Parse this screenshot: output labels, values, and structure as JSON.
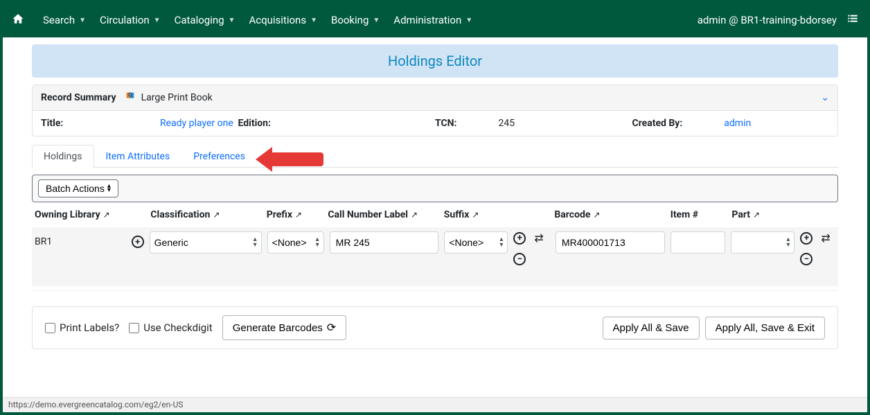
{
  "nav": {
    "items": [
      "Search",
      "Circulation",
      "Cataloging",
      "Acquisitions",
      "Booking",
      "Administration"
    ],
    "user_text": "admin @ BR1-training-bdorsey"
  },
  "banner": {
    "title": "Holdings Editor"
  },
  "record_summary": {
    "label": "Record Summary",
    "format": "Large Print Book",
    "fields": {
      "title_label": "Title:",
      "title_value": "Ready player one",
      "edition_label": "Edition:",
      "edition_value": "",
      "tcn_label": "TCN:",
      "tcn_value": "245",
      "created_label": "Created By:",
      "created_value": "admin"
    }
  },
  "tabs": {
    "items": [
      {
        "label": "Holdings",
        "active": true
      },
      {
        "label": "Item Attributes",
        "active": false
      },
      {
        "label": "Preferences",
        "active": false
      }
    ]
  },
  "batch": {
    "button": "Batch Actions"
  },
  "columns": {
    "owning": "Owning Library",
    "classification": "Classification",
    "prefix": "Prefix",
    "cnl": "Call Number Label",
    "suffix": "Suffix",
    "barcode": "Barcode",
    "itemno": "Item #",
    "part": "Part"
  },
  "row": {
    "owning": "BR1",
    "classification": "Generic",
    "prefix": "<None>",
    "cnl": "MR 245",
    "suffix": "<None>",
    "barcode": "MR400001713",
    "itemno": "",
    "part": ""
  },
  "footer": {
    "print_labels": "Print Labels?",
    "use_checkdigit": "Use Checkdigit",
    "generate": "Generate Barcodes",
    "apply_save": "Apply All & Save",
    "apply_save_exit": "Apply All, Save & Exit"
  },
  "status_url": "https://demo.evergreencatalog.com/eg2/en-US"
}
